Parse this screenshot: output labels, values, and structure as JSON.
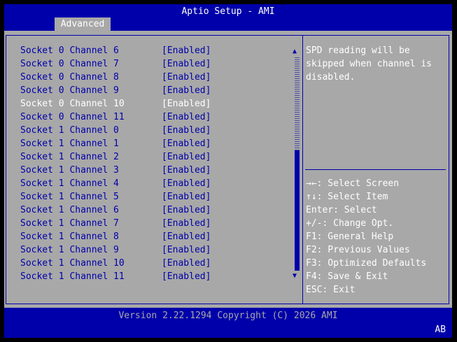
{
  "window": {
    "title": "Aptio Setup - AMI"
  },
  "tabs": [
    {
      "label": "Advanced"
    }
  ],
  "settings": [
    {
      "label": "Socket 0 Channel 6",
      "value": "[Enabled]"
    },
    {
      "label": "Socket 0 Channel 7",
      "value": "[Enabled]"
    },
    {
      "label": "Socket 0 Channel 8",
      "value": "[Enabled]"
    },
    {
      "label": "Socket 0 Channel 9",
      "value": "[Enabled]"
    },
    {
      "label": "Socket 0 Channel 10",
      "value": "[Enabled]"
    },
    {
      "label": "Socket 0 Channel 11",
      "value": "[Enabled]"
    },
    {
      "label": "Socket 1 Channel 0",
      "value": "[Enabled]"
    },
    {
      "label": "Socket 1 Channel 1",
      "value": "[Enabled]"
    },
    {
      "label": "Socket 1 Channel 2",
      "value": "[Enabled]"
    },
    {
      "label": "Socket 1 Channel 3",
      "value": "[Enabled]"
    },
    {
      "label": "Socket 1 Channel 4",
      "value": "[Enabled]"
    },
    {
      "label": "Socket 1 Channel 5",
      "value": "[Enabled]"
    },
    {
      "label": "Socket 1 Channel 6",
      "value": "[Enabled]"
    },
    {
      "label": "Socket 1 Channel 7",
      "value": "[Enabled]"
    },
    {
      "label": "Socket 1 Channel 8",
      "value": "[Enabled]"
    },
    {
      "label": "Socket 1 Channel 9",
      "value": "[Enabled]"
    },
    {
      "label": "Socket 1 Channel 10",
      "value": "[Enabled]"
    },
    {
      "label": "Socket 1 Channel 11",
      "value": "[Enabled]"
    }
  ],
  "selected_index": 4,
  "help": {
    "text": "SPD reading will be skipped when channel is disabled."
  },
  "keys": [
    "→←: Select Screen",
    "↑↓: Select Item",
    "Enter: Select",
    "+/-: Change Opt.",
    "F1: General Help",
    "F2: Previous Values",
    "F3: Optimized Defaults",
    "F4: Save & Exit",
    "ESC: Exit"
  ],
  "footer": {
    "version": "Version 2.22.1294 Copyright (C) 2026 AMI",
    "badge": "AB"
  },
  "scrollbar": {
    "up_glyph": "▲",
    "down_glyph": "▼"
  },
  "colors": {
    "background": "#a8a8a8",
    "accent": "#0000aa",
    "selected_text": "#ffffff",
    "normal_text": "#0000aa"
  }
}
